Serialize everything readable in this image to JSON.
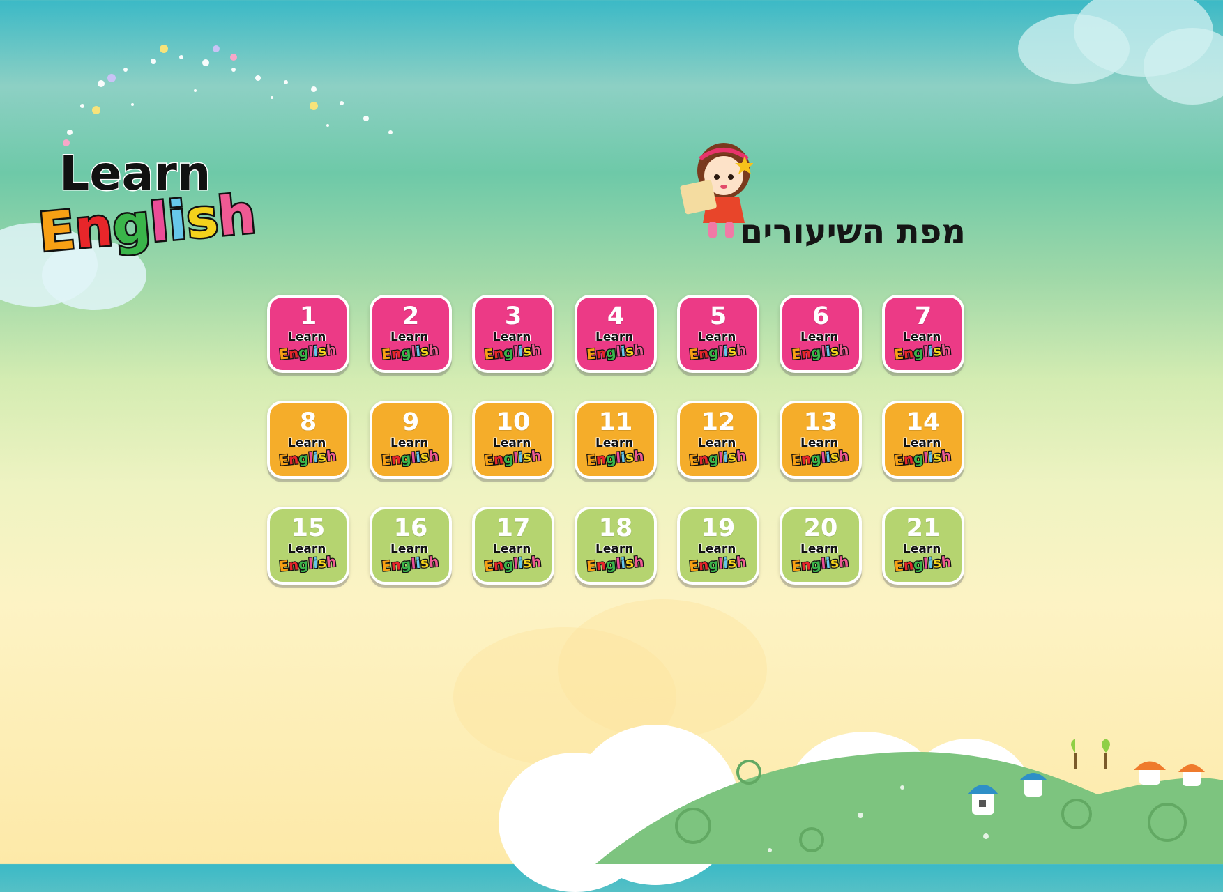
{
  "logo": {
    "line1": "Learn",
    "line2": "English"
  },
  "page_title": "מפת השיעורים",
  "tile_brand": {
    "line1": "Learn",
    "line2": "English"
  },
  "colors": {
    "row1": "#ec3a86",
    "row2": "#f5ad2a",
    "row3": "#b5d470",
    "logo_letters": [
      "#f7a014",
      "#e8262a",
      "#3ab54a",
      "#ea4d97",
      "#67c7ea",
      "#f4d21c",
      "#ef5a93"
    ]
  },
  "lessons": [
    {
      "number": "1"
    },
    {
      "number": "2"
    },
    {
      "number": "3"
    },
    {
      "number": "4"
    },
    {
      "number": "5"
    },
    {
      "number": "6"
    },
    {
      "number": "7"
    },
    {
      "number": "8"
    },
    {
      "number": "9"
    },
    {
      "number": "10"
    },
    {
      "number": "11"
    },
    {
      "number": "12"
    },
    {
      "number": "13"
    },
    {
      "number": "14"
    },
    {
      "number": "15"
    },
    {
      "number": "16"
    },
    {
      "number": "17"
    },
    {
      "number": "18"
    },
    {
      "number": "19"
    },
    {
      "number": "20"
    },
    {
      "number": "21"
    }
  ]
}
